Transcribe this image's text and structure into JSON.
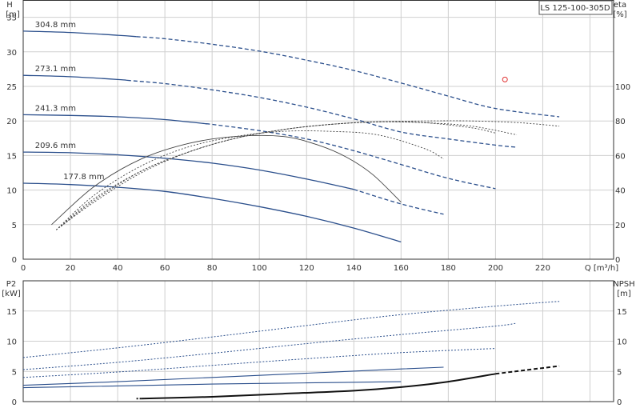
{
  "chart_data": [
    {
      "type": "line",
      "title": "LS 125-100-305D",
      "xlabel": "Q [m³/h]",
      "ylabel_left": [
        "H",
        "[m]"
      ],
      "ylabel_right": [
        "eta",
        "[%]"
      ],
      "xlim": [
        0,
        250
      ],
      "ylim": [
        0,
        37.5
      ],
      "y2lim": [
        0,
        150
      ],
      "grid": true,
      "xticks": [
        0,
        20,
        40,
        60,
        80,
        100,
        120,
        140,
        160,
        180,
        200,
        220
      ],
      "yticks": [
        0,
        5,
        10,
        15,
        20,
        25,
        30,
        35
      ],
      "y2ticks": [
        0,
        20,
        40,
        60,
        80,
        100
      ],
      "head_curves": [
        {
          "name": "304.8 mm",
          "x": [
            0,
            20,
            40,
            60,
            80,
            100,
            120,
            140,
            160,
            180,
            200,
            227
          ],
          "y": [
            33.0,
            32.8,
            32.4,
            31.9,
            31.1,
            30.1,
            28.8,
            27.3,
            25.5,
            23.6,
            21.8,
            20.6
          ],
          "solid_to": 48,
          "color": "#2b4f8c"
        },
        {
          "name": "273.1 mm",
          "x": [
            0,
            20,
            40,
            60,
            80,
            100,
            120,
            140,
            160,
            180,
            200,
            209
          ],
          "y": [
            26.6,
            26.4,
            26.0,
            25.4,
            24.5,
            23.4,
            22.0,
            20.3,
            18.4,
            17.4,
            16.5,
            16.2
          ],
          "solid_to": 44,
          "color": "#2b4f8c"
        },
        {
          "name": "241.3 mm",
          "x": [
            0,
            20,
            40,
            60,
            80,
            100,
            120,
            140,
            160,
            180,
            200
          ],
          "y": [
            20.9,
            20.8,
            20.6,
            20.2,
            19.5,
            18.6,
            17.4,
            15.7,
            13.7,
            11.7,
            10.2
          ],
          "solid_to": 78,
          "color": "#2b4f8c"
        },
        {
          "name": "209.6 mm",
          "x": [
            0,
            20,
            40,
            60,
            80,
            100,
            120,
            140,
            160,
            178
          ],
          "y": [
            15.5,
            15.4,
            15.1,
            14.6,
            13.9,
            12.9,
            11.6,
            10.1,
            8.0,
            6.5
          ],
          "solid_to": 140,
          "color": "#2b4f8c"
        },
        {
          "name": "177.8 mm",
          "x": [
            0,
            20,
            40,
            60,
            80,
            100,
            120,
            140,
            160
          ],
          "y": [
            11.0,
            10.8,
            10.4,
            9.8,
            8.8,
            7.6,
            6.2,
            4.5,
            2.5
          ],
          "solid_to": 160,
          "color": "#2b4f8c"
        }
      ],
      "efficiency_curves": [
        {
          "x": [
            14,
            30,
            50,
            70,
            90,
            110,
            130,
            150,
            170,
            190,
            210,
            227
          ],
          "y": [
            17,
            35,
            51,
            62,
            70,
            75,
            78,
            79.5,
            80,
            80,
            79,
            77
          ],
          "style": "dotted"
        },
        {
          "x": [
            16,
            30,
            50,
            70,
            90,
            110,
            130,
            150,
            170,
            190,
            200
          ],
          "y": [
            19,
            34,
            51,
            62,
            70,
            75,
            78,
            79.5,
            79,
            76,
            73
          ],
          "style": "dotted"
        },
        {
          "x": [
            14,
            30,
            50,
            70,
            90,
            110,
            130,
            150,
            170,
            190,
            209
          ],
          "y": [
            17,
            33,
            50,
            62,
            70,
            75,
            78,
            79.5,
            79,
            77,
            72
          ],
          "style": "dotted"
        },
        {
          "x": [
            14,
            30,
            50,
            70,
            90,
            110,
            130,
            150,
            170,
            178
          ],
          "y": [
            17,
            37,
            54,
            65,
            71,
            74,
            74,
            72,
            64,
            58
          ],
          "style": "dotted"
        },
        {
          "x": [
            12,
            30,
            50,
            70,
            90,
            110,
            125,
            137,
            148,
            160
          ],
          "y": [
            20,
            42,
            58,
            67,
            71,
            71,
            66,
            59,
            49,
            33
          ],
          "style": "solid"
        }
      ],
      "duty_point": {
        "x": 204,
        "y": 26,
        "color": "#e03030"
      }
    },
    {
      "type": "line",
      "ylabel_left": [
        "P2",
        "[kW]"
      ],
      "ylabel_right": [
        "NPSH",
        "[m]"
      ],
      "xlim": [
        0,
        250
      ],
      "ylim": [
        0,
        20
      ],
      "y2lim": [
        0,
        20
      ],
      "grid": true,
      "yticks": [
        0,
        5,
        10,
        15
      ],
      "y2ticks": [
        0,
        5,
        10,
        15
      ],
      "power_curves": [
        {
          "x": [
            0,
            40,
            80,
            120,
            160,
            200,
            227
          ],
          "y": [
            7.3,
            8.9,
            10.7,
            12.6,
            14.4,
            15.8,
            16.6
          ],
          "style": "dotted",
          "color": "#2b4f8c"
        },
        {
          "x": [
            0,
            40,
            80,
            120,
            160,
            200,
            209
          ],
          "y": [
            5.3,
            6.5,
            8.0,
            9.6,
            11.1,
            12.5,
            13.0
          ],
          "style": "dotted",
          "color": "#2b4f8c"
        },
        {
          "x": [
            0,
            40,
            80,
            120,
            160,
            200
          ],
          "y": [
            4.0,
            4.9,
            6.0,
            7.1,
            8.1,
            8.8
          ],
          "style": "dotted",
          "color": "#2b4f8c"
        },
        {
          "x": [
            0,
            40,
            80,
            120,
            160,
            178
          ],
          "y": [
            2.7,
            3.3,
            4.0,
            4.7,
            5.4,
            5.7
          ],
          "style": "solid",
          "color": "#2b4f8c"
        },
        {
          "x": [
            0,
            40,
            80,
            120,
            160
          ],
          "y": [
            2.3,
            2.6,
            2.9,
            3.1,
            3.3
          ],
          "style": "solid",
          "color": "#2b4f8c"
        }
      ],
      "npsh_curve": {
        "x": [
          50,
          80,
          110,
          140,
          160,
          180,
          200,
          227
        ],
        "y": [
          0.5,
          0.8,
          1.3,
          1.8,
          2.4,
          3.3,
          4.6,
          5.9
        ],
        "solid_to": 200,
        "color": "#111111"
      }
    }
  ]
}
